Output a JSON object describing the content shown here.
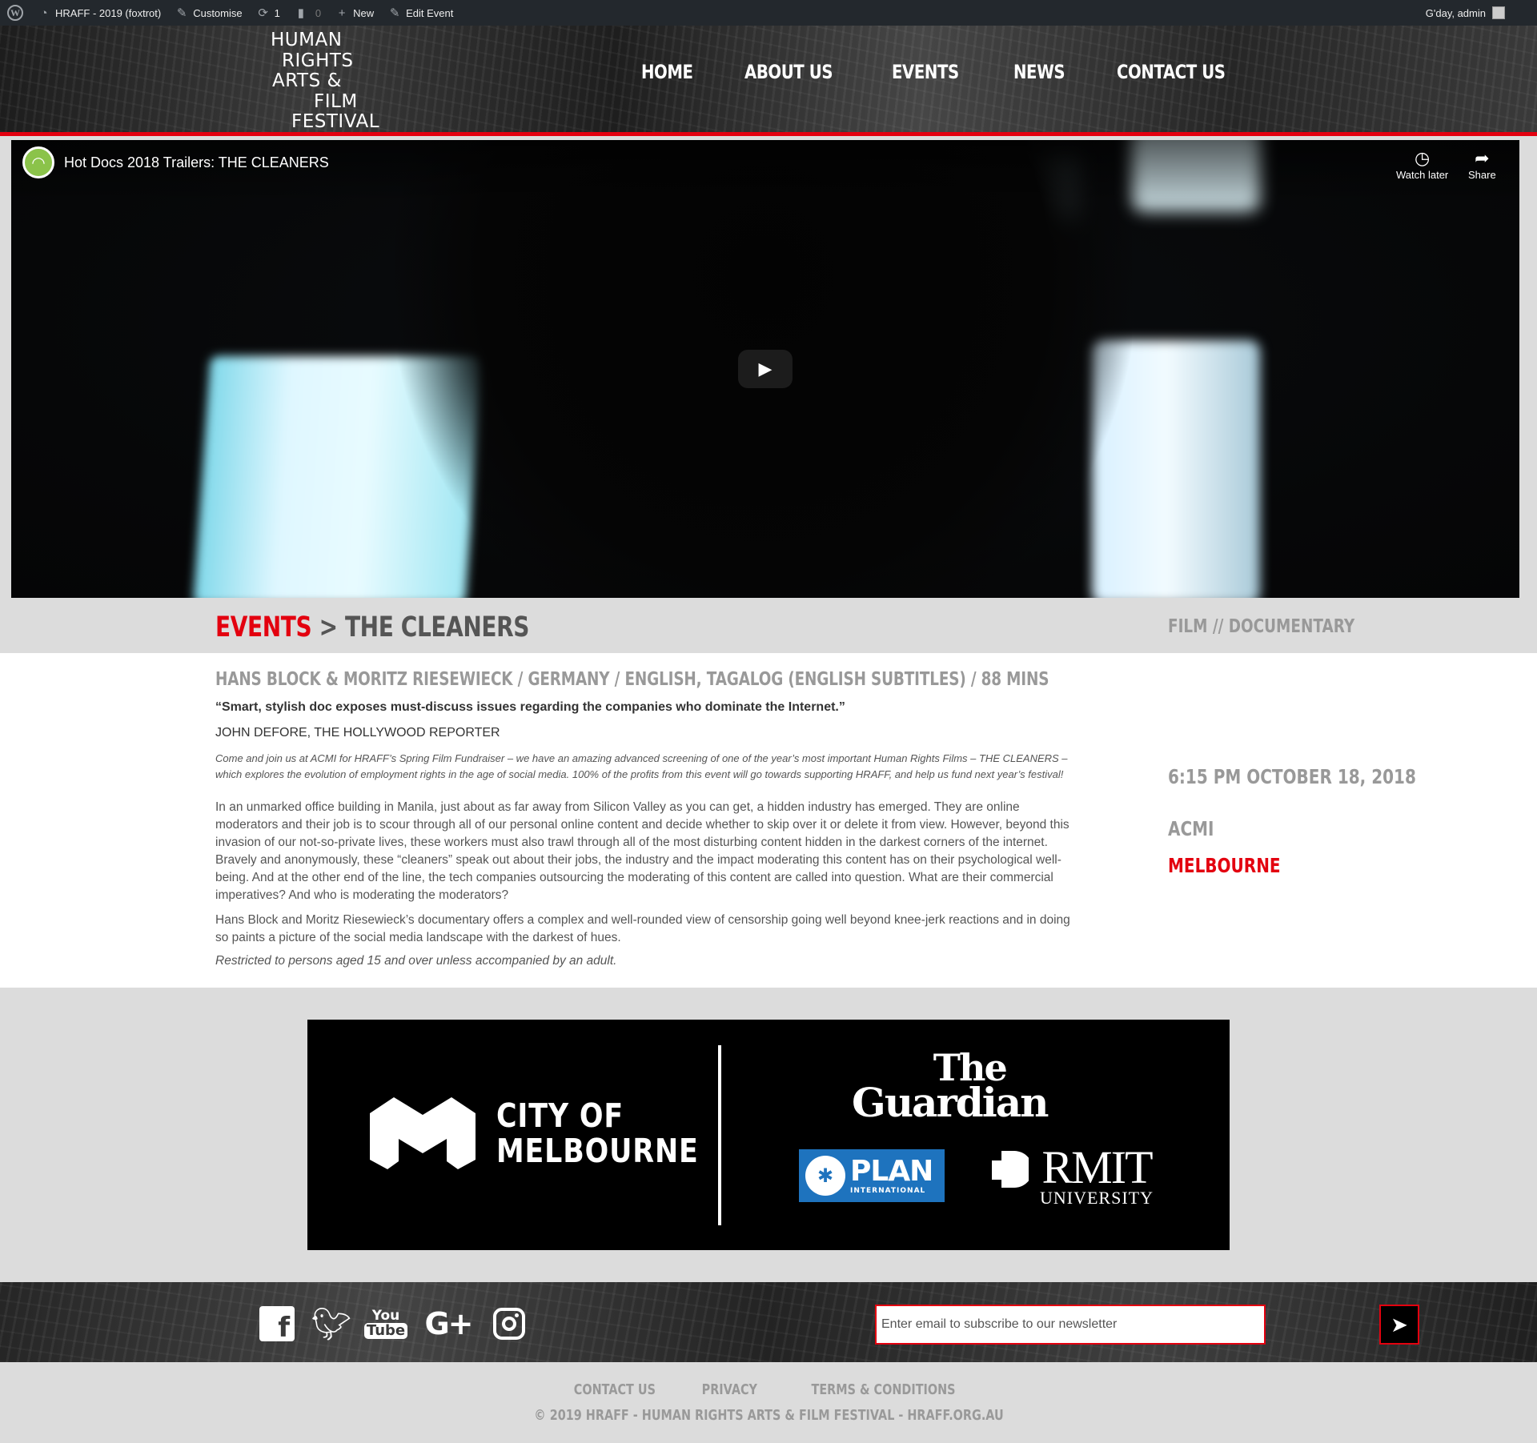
{
  "admin_bar": {
    "site_name": "HRAFF - 2019 (foxtrot)",
    "customise": "Customise",
    "updates_count": "1",
    "comments_count": "0",
    "new": "New",
    "edit_event": "Edit Event",
    "greeting": "G'day, admin"
  },
  "logo": {
    "lines": [
      "HUMAN",
      "RIGHTS",
      "ARTS &",
      "FILM",
      "FESTIVAL"
    ]
  },
  "nav": [
    "HOME",
    "ABOUT US",
    "EVENTS",
    "NEWS",
    "CONTACT US"
  ],
  "video": {
    "title": "Hot Docs 2018 Trailers: THE CLEANERS",
    "watch_later": "Watch later",
    "share": "Share"
  },
  "breadcrumb": {
    "section": "EVENTS",
    "separator": ">",
    "current": "THE CLEANERS"
  },
  "event": {
    "genre": "FILM // DOCUMENTARY",
    "credits": "HANS BLOCK & MORITZ RIESEWIECK / GERMANY / ENGLISH, TAGALOG (ENGLISH SUBTITLES) / 88 MINS",
    "quote": "“Smart, stylish doc exposes must-discuss issues regarding the companies who dominate the Internet.”",
    "quote_source": "JOHN DEFORE, THE HOLLYWOOD REPORTER",
    "intro": "Come and join us at ACMI for HRAFF’s Spring Film Fundraiser – we have an amazing advanced screening of one of the year’s most important Human Rights Films – THE CLEANERS – which explores the evolution of employment rights in the age of social media. 100% of the profits from this event will go towards supporting HRAFF, and help us fund next year’s festival!",
    "body1": "In an unmarked office building in Manila, just about as far away from Silicon Valley as you can get, a hidden industry has emerged.  They are online moderators and their job is to scour through all of our personal online content and decide whether to skip over it or delete it from view.  However, beyond this invasion of our not-so-private lives, these workers must also trawl through all of the most disturbing content hidden in the darkest corners of the internet.  Bravely and anonymously, these “cleaners” speak out about their jobs, the industry and the impact moderating this content has on their psychological well-being.  And at the other end of the line, the tech companies outsourcing the moderating of this content are called into question.  What are their commercial imperatives?  And who is moderating the moderators?",
    "body2": "Hans Block and Moritz Riesewieck’s documentary offers a complex and well-rounded view of censorship going well beyond knee-jerk reactions and in doing so paints a picture of the social media landscape with the darkest of hues.",
    "restriction": "Restricted to persons aged 15 and over unless accompanied by an adult.",
    "datetime": "6:15 PM OCTOBER 18, 2018",
    "venue": "ACMI",
    "city": "MELBOURNE"
  },
  "sponsors": {
    "city_of_melbourne": [
      "CITY OF",
      "MELBOURNE"
    ],
    "guardian": [
      "The",
      "Guardian"
    ],
    "plan": [
      "PLAN",
      "INTERNATIONAL"
    ],
    "rmit": [
      "RMIT",
      "UNIVERSITY"
    ]
  },
  "footer": {
    "social": {
      "facebook": "f",
      "youtube_top": "You",
      "youtube_bottom": "Tube",
      "googleplus": "G+"
    },
    "newsletter_placeholder": "Enter email to subscribe to our newsletter",
    "links": [
      "CONTACT US",
      "PRIVACY",
      "TERMS & CONDITIONS"
    ],
    "copyright": "© 2019 HRAFF - HUMAN RIGHTS ARTS & FILM FESTIVAL - HRAFF.ORG.AU"
  },
  "colors": {
    "accent_red": "#e3000f",
    "admin_bar": "#23282d",
    "muted_text": "#999999"
  },
  "icons": [
    "wordpress-icon",
    "dashboard-icon",
    "brush-icon",
    "updates-icon",
    "comment-icon",
    "plus-icon",
    "pencil-icon",
    "clock-icon",
    "share-icon",
    "play-icon",
    "facebook-icon",
    "twitter-icon",
    "youtube-icon",
    "googleplus-icon",
    "instagram-icon",
    "send-icon"
  ]
}
